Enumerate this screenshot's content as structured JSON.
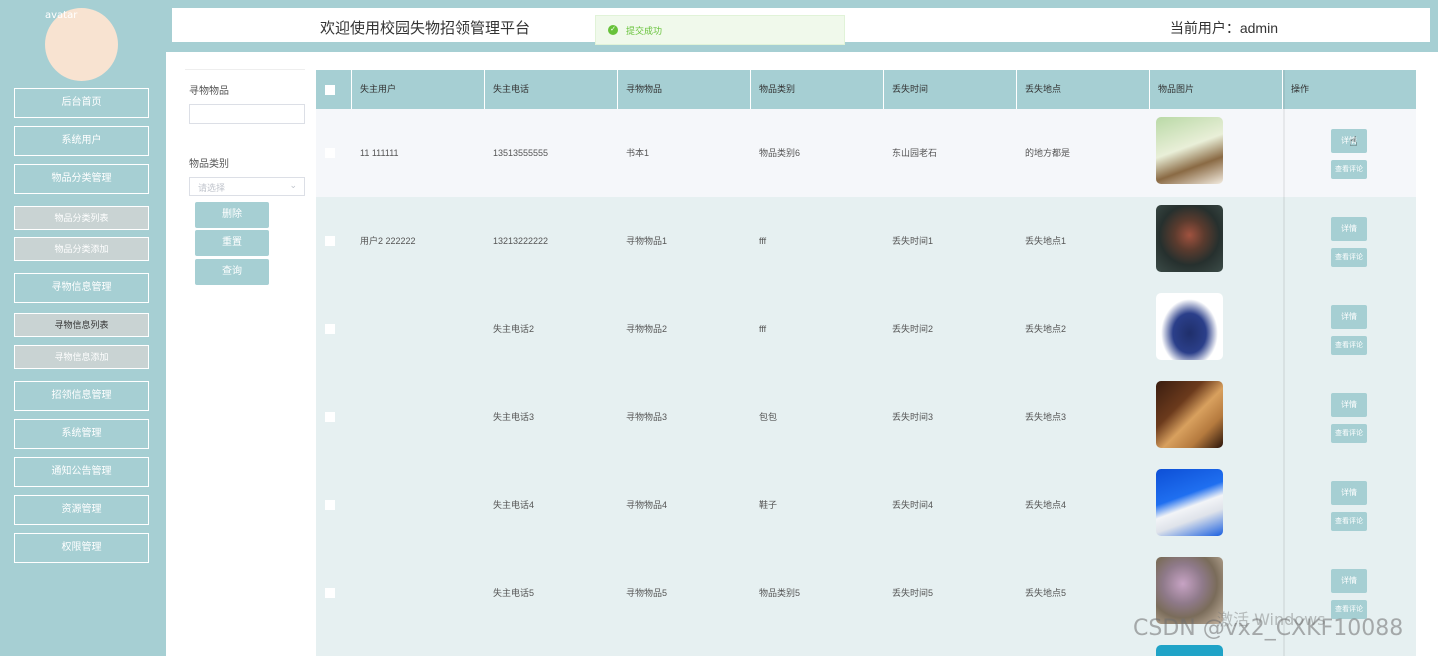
{
  "header": {
    "title": "欢迎使用校园失物招领管理平台",
    "user": "当前用户：admin",
    "toast": "提交成功"
  },
  "sidebar": {
    "avatar_alt": "avatar",
    "items": [
      {
        "label": "后台首页"
      },
      {
        "label": "系统用户"
      },
      {
        "label": "物品分类管理"
      },
      {
        "label": "物品分类列表"
      },
      {
        "label": "物品分类添加"
      },
      {
        "label": "寻物信息管理"
      },
      {
        "label": "寻物信息列表"
      },
      {
        "label": "寻物信息添加"
      },
      {
        "label": "招领信息管理"
      },
      {
        "label": "系统管理"
      },
      {
        "label": "通知公告管理"
      },
      {
        "label": "资源管理"
      },
      {
        "label": "权限管理"
      }
    ]
  },
  "filter": {
    "name_label": "寻物物品",
    "category_label": "物品类别",
    "category_placeholder": "请选择",
    "delete_label": "删除",
    "reset_label": "重置",
    "search_label": "查询"
  },
  "table": {
    "columns": [
      "失主用户",
      "失主电话",
      "寻物物品",
      "物品类别",
      "丢失时间",
      "丢失地点",
      "物品图片",
      "操作"
    ],
    "rows": [
      {
        "user": "11 111111",
        "phone": "13513555555",
        "item": "书本1",
        "category": "物品类别6",
        "time": "东山园老石",
        "place": "的地方都是",
        "image": "book-photo"
      },
      {
        "user": "用户2 222222",
        "phone": "13213222222",
        "item": "寻物物品1",
        "category": "fff",
        "time": "丢失时间1",
        "place": "丢失地点1",
        "image": "plush-toy-photo"
      },
      {
        "user": "",
        "phone": "失主电话2",
        "item": "寻物物品2",
        "category": "fff",
        "time": "丢失时间2",
        "place": "丢失地点2",
        "image": "handbag-photo"
      },
      {
        "user": "",
        "phone": "失主电话3",
        "item": "寻物物品3",
        "category": "包包",
        "time": "丢失时间3",
        "place": "丢失地点3",
        "image": "wallet-photo"
      },
      {
        "user": "",
        "phone": "失主电话4",
        "item": "寻物物品4",
        "category": "鞋子",
        "time": "丢失时间4",
        "place": "丢失地点4",
        "image": "sneaker-photo"
      },
      {
        "user": "",
        "phone": "失主电话5",
        "item": "寻物物品5",
        "category": "物品类别5",
        "time": "丢失时间5",
        "place": "丢失地点5",
        "image": "keychain-photo"
      }
    ],
    "detail_label": "详情",
    "comment_label": "查看评论"
  },
  "watermarks": {
    "activate": "激活 Windows",
    "csdn": "CSDN @vx2_CXKF10088"
  }
}
